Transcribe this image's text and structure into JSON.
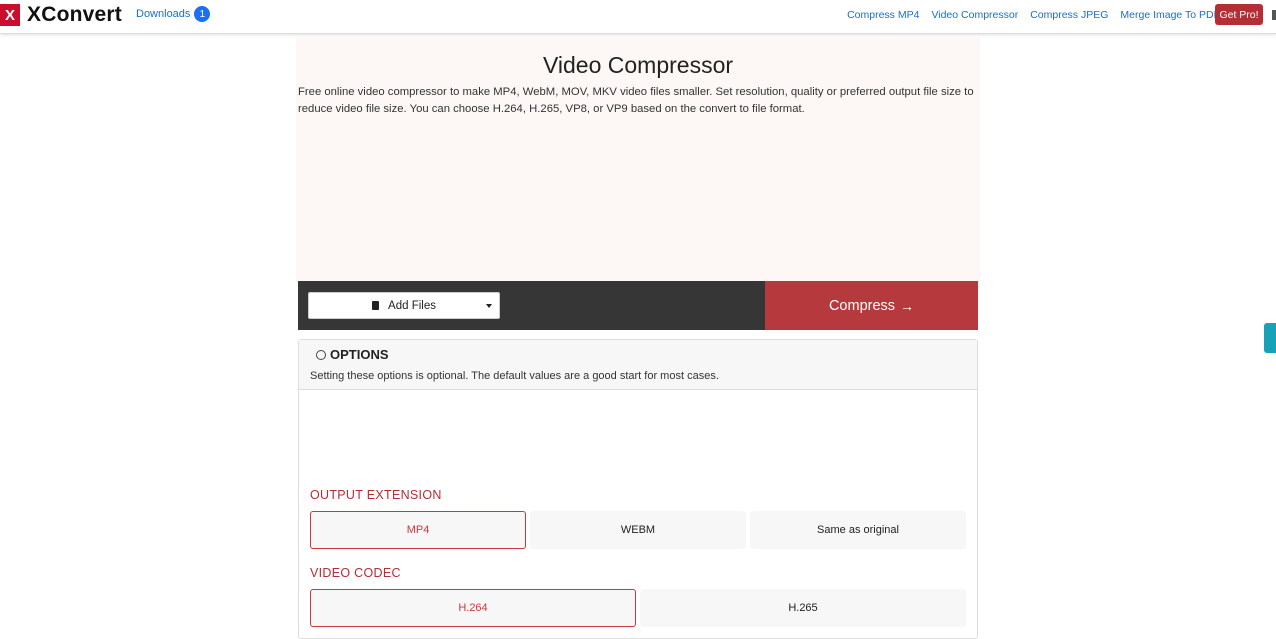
{
  "brand": {
    "logo_letter": "X",
    "name": "XConvert"
  },
  "nav": {
    "downloads_label": "Downloads",
    "downloads_count": "1",
    "links": [
      "Compress MP4",
      "Video Compressor",
      "Compress JPEG",
      "Merge Image To PDF"
    ],
    "get_pro": "Get Pro!"
  },
  "hero": {
    "title": "Video Compressor",
    "description": "Free online video compressor to make MP4, WebM, MOV, MKV video files smaller. Set resolution, quality or preferred output file size to reduce video file size. You can choose H.264, H.265, VP8, or VP9 based on the convert to file format."
  },
  "actions": {
    "add_files": "Add Files",
    "compress": "Compress",
    "compress_arrow": "→"
  },
  "options": {
    "title": "OPTIONS",
    "subtitle": "Setting these options is optional. The default values are a good start for most cases.",
    "output_extension": {
      "label": "OUTPUT EXTENSION",
      "choices": [
        "MP4",
        "WEBM",
        "Same as original"
      ],
      "selected": "MP4"
    },
    "video_codec": {
      "label": "VIDEO CODEC",
      "choices": [
        "H.264",
        "H.265"
      ],
      "selected": "H.264"
    }
  },
  "colors": {
    "accent": "#b6393d",
    "link": "#1a6fc9",
    "badge": "#1b6ff0",
    "action_bar": "#363636"
  }
}
